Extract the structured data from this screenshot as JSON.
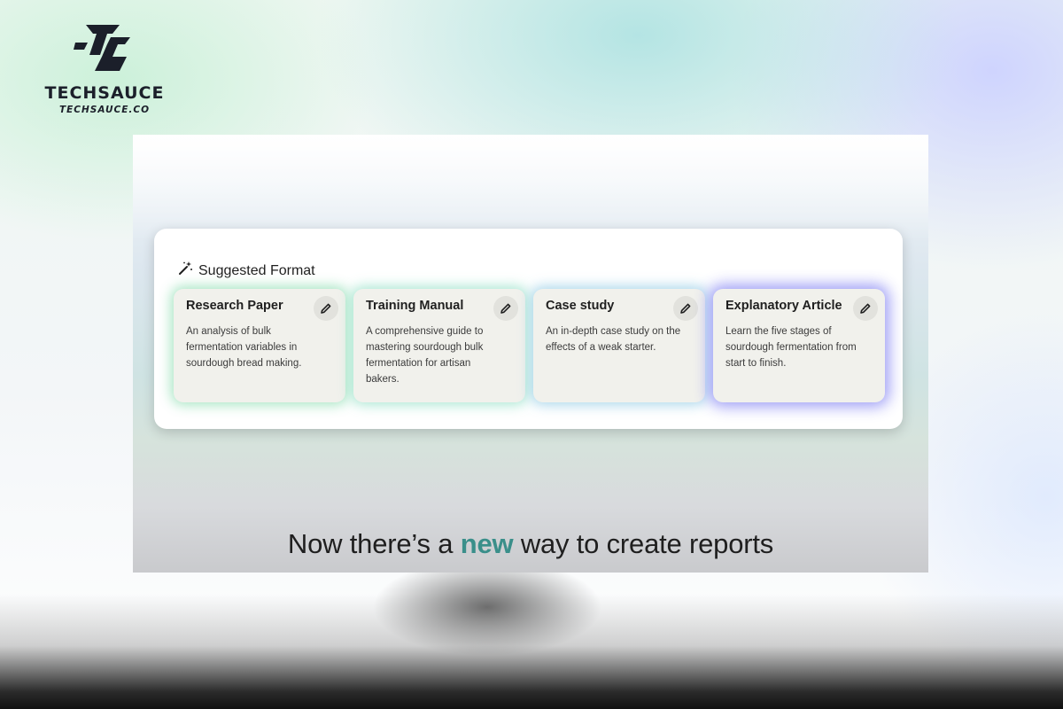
{
  "logo": {
    "name": "TECHSAUCE",
    "domain": "TECHSAUCE.CO",
    "icon": "techsauce-ts-mark"
  },
  "panel": {
    "title": "Suggested Format",
    "title_icon": "magic-wand-icon",
    "cards": [
      {
        "title": "Research Paper",
        "description": "An analysis of bulk fermentation variables in sourdough bread making.",
        "action_icon": "pencil-icon"
      },
      {
        "title": "Training Manual",
        "description": "A comprehensive guide to mastering sourdough bulk fermentation for artisan bakers.",
        "action_icon": "pencil-icon"
      },
      {
        "title": "Case study",
        "description": "An in-depth case study on the effects of a weak starter.",
        "action_icon": "pencil-icon"
      },
      {
        "title": "Explanatory Article",
        "description": "Learn the five stages of sourdough fermentation from start to finish.",
        "action_icon": "pencil-icon"
      }
    ]
  },
  "caption": {
    "before": "Now there’s a",
    "highlight": "new",
    "after": "way to create reports"
  },
  "colors": {
    "accent": "#3a8f8a",
    "card_background": "#f1f1ec",
    "glow_green": "#96e1b9",
    "glow_purple": "#9696f5"
  }
}
